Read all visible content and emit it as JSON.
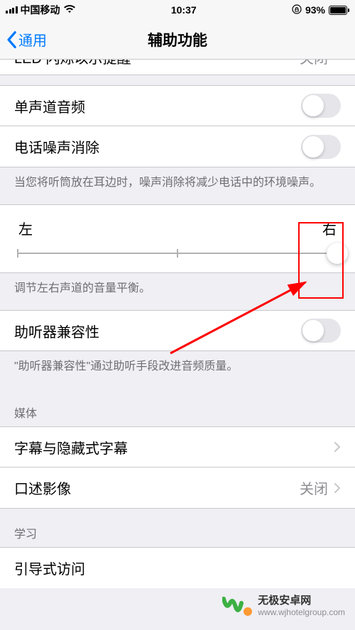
{
  "status": {
    "carrier": "中国移动",
    "time": "10:37",
    "battery": "93%"
  },
  "nav": {
    "back": "通用",
    "title": "辅助功能"
  },
  "rows": {
    "led": {
      "label": "LED 闪烁以示提醒",
      "value": "关闭"
    },
    "mono": {
      "label": "单声道音频"
    },
    "noise": {
      "label": "电话噪声消除"
    },
    "hearing": {
      "label": "助听器兼容性"
    },
    "subtitles": {
      "label": "字幕与隐藏式字幕"
    },
    "audiodesc": {
      "label": "口述影像",
      "value": "关闭"
    },
    "guided": {
      "label": "引导式访问"
    }
  },
  "slider": {
    "left": "左",
    "right": "右"
  },
  "footers": {
    "noise": "当您将听筒放在耳边时，噪声消除将减少电话中的环境噪声。",
    "balance": "调节左右声道的音量平衡。",
    "hearing": "\"助听器兼容性\"通过助听手段改进音频质量。"
  },
  "sections": {
    "media": "媒体",
    "learning": "学习"
  },
  "watermark": {
    "line1": "无极安卓网",
    "line2": "www.wjhotelgroup.com"
  }
}
